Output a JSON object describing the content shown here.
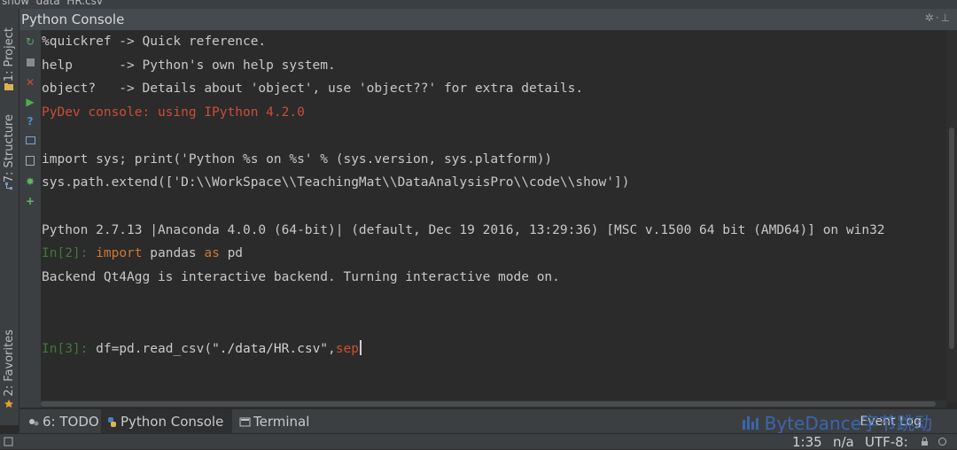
{
  "top_tabs": "show  data  HR.csv",
  "side_tabs": {
    "project": "1: Project",
    "structure": "7: Structure",
    "favorites": "2: Favorites"
  },
  "panel_title": "Python Console",
  "console": {
    "help_lines": [
      "%quickref -> Quick reference.",
      "help      -> Python's own help system.",
      "object?   -> Details about 'object', use 'object??' for extra details."
    ],
    "banner": "PyDev console: using IPython 4.2.0",
    "import_line": "import sys; print('Python %s on %s' % (sys.version, sys.platform))",
    "path_line": "sys.path.extend(['D:\\\\WorkSpace\\\\TeachingMat\\\\DataAnalysisPro\\\\code\\\\show'])",
    "python_version": "Python 2.7.13 |Anaconda 4.0.0 (64-bit)| (default, Dec 19 2016, 13:29:36) [MSC v.1500 64 bit (AMD64)] on win32",
    "prompt2": "In[2]:",
    "in2_keyword": "import",
    "in2_module": "pandas",
    "in2_as": "as",
    "in2_alias": "pd",
    "backend_line": "Backend Qt4Agg is interactive backend. Turning interactive mode on.",
    "prompt3": "In[3]:",
    "in3_code": "df=pd.read_csv(",
    "in3_string": "\"./data/HR.csv\"",
    "in3_comma": ",",
    "in3_sep": "sep"
  },
  "bottom_tabs": {
    "todo": "6: TODO",
    "console": "Python Console",
    "terminal": "Terminal"
  },
  "event_log": "Event Log",
  "watermark": "ByteDance字节跳动",
  "status": {
    "position": "1:35",
    "na": "n/a",
    "encoding": "UTF-8:"
  },
  "colors": {
    "background": "#2b2b2b",
    "error": "#cc4d3a",
    "prompt": "#3f7a38",
    "keyword": "#cc7832",
    "sep": "#c9522f"
  }
}
